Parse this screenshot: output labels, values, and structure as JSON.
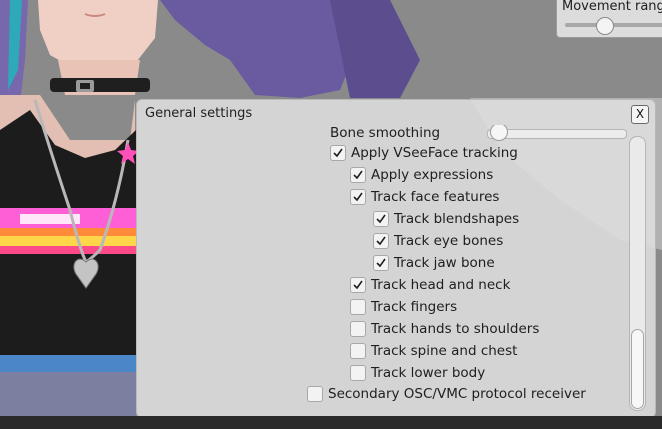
{
  "movement_panel": {
    "title": "Movement range",
    "slider_value": 0.35
  },
  "dialog": {
    "title": "General settings",
    "close_label": "X",
    "bone_smoothing": {
      "label": "Bone smoothing",
      "value": 0.08
    },
    "items": [
      {
        "label": "Apply VSeeFace tracking",
        "checked": true,
        "level": 0
      },
      {
        "label": "Apply expressions",
        "checked": true,
        "level": 1
      },
      {
        "label": "Track face features",
        "checked": true,
        "level": 1
      },
      {
        "label": "Track blendshapes",
        "checked": true,
        "level": 2
      },
      {
        "label": "Track eye bones",
        "checked": true,
        "level": 2
      },
      {
        "label": "Track jaw bone",
        "checked": true,
        "level": 2
      },
      {
        "label": "Track head and neck",
        "checked": true,
        "level": 1
      },
      {
        "label": "Track fingers",
        "checked": false,
        "level": 1
      },
      {
        "label": "Track hands to shoulders",
        "checked": false,
        "level": 1
      },
      {
        "label": "Track spine and chest",
        "checked": false,
        "level": 1
      },
      {
        "label": "Track lower body",
        "checked": false,
        "level": 1
      },
      {
        "label": "Secondary OSC/VMC protocol receiver",
        "checked": false,
        "level": -1
      }
    ]
  },
  "scene": {
    "character_hair_color": "#6a5aa0",
    "background_color": "#8a8a8a"
  }
}
